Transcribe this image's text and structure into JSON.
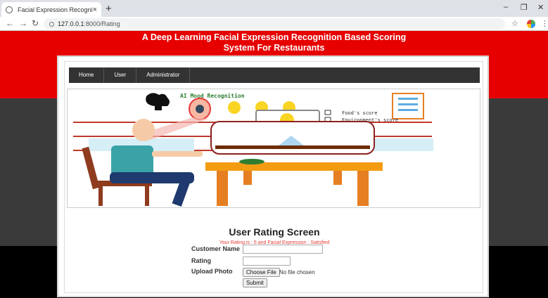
{
  "browser": {
    "tab_title": "Facial Expression Recognition",
    "tab_close": "×",
    "new_tab": "+",
    "url_host": "127.0.0.1",
    "url_rest": ":8000/Rating",
    "min": "–",
    "max": "❐",
    "close": "✕",
    "back": "←",
    "forward": "→",
    "reload": "↻",
    "star": "☆",
    "menu": "⋮"
  },
  "header": {
    "title_line1": "A Deep Learning Facial Expression Recognition Based Scoring",
    "title_line2": "System For Restaurants"
  },
  "nav": {
    "items": [
      "Home",
      "User",
      "Administrator"
    ]
  },
  "banner": {
    "ai_label": "AI Mood Recognition",
    "food_score": "Food's score",
    "env_score": "Environment's score"
  },
  "form": {
    "title": "User Rating Screen",
    "message": "Your Rating is : 5 and Facial Expression : Satisfied",
    "name_label": "Customer Name",
    "rating_label": "Rating",
    "upload_label": "Upload Photo",
    "file_button": "Choose File",
    "file_status": "No file chosen",
    "submit": "Submit"
  },
  "colors": {
    "header_red": "#e60000",
    "nav_dark": "#333333",
    "message_red": "#e53935"
  }
}
